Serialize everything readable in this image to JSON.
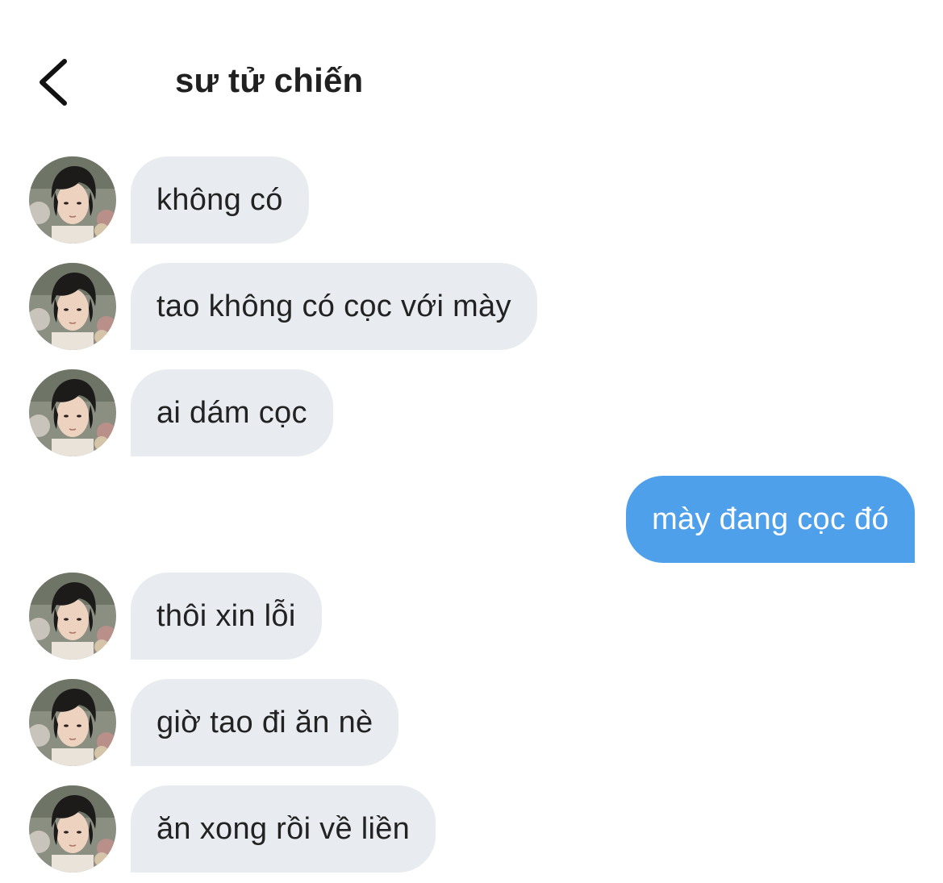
{
  "header": {
    "title": "sư tử chiến",
    "back_icon": "chevron-left-icon"
  },
  "colors": {
    "incoming_bubble": "#e8ebef",
    "outgoing_bubble": "#4fa0eb",
    "incoming_text": "#222222",
    "outgoing_text": "#ffffff",
    "background": "#ffffff"
  },
  "messages": [
    {
      "sender": "them",
      "text": "không có"
    },
    {
      "sender": "them",
      "text": "tao không có cọc với mày"
    },
    {
      "sender": "them",
      "text": "ai dám cọc"
    },
    {
      "sender": "me",
      "text": "mày đang cọc đó"
    },
    {
      "sender": "them",
      "text": "thôi xin lỗi"
    },
    {
      "sender": "them",
      "text": "giờ tao đi ăn nè"
    },
    {
      "sender": "them",
      "text": "ăn xong rồi về liền"
    }
  ]
}
